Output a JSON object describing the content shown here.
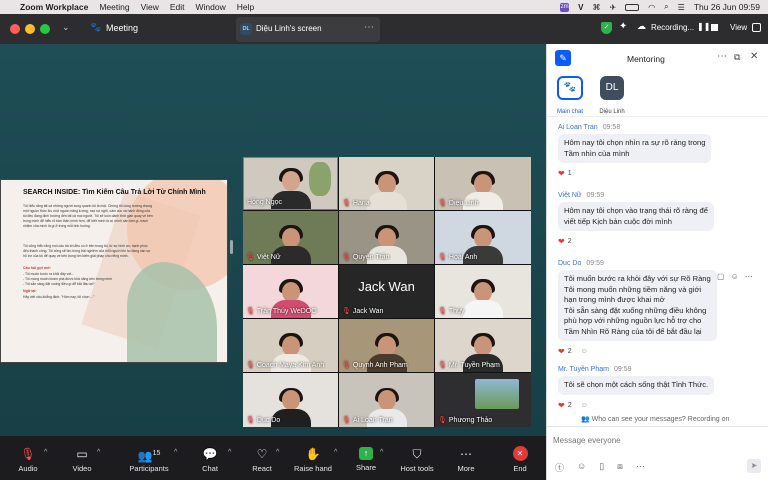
{
  "menubar": {
    "app": "Zoom Workplace",
    "items": [
      "Meeting",
      "View",
      "Edit",
      "Window",
      "Help"
    ],
    "clock": "Thu 26 Jun  09:59"
  },
  "titlebar": {
    "meeting_label": "Meeting",
    "share_tab_initials": "DL",
    "share_tab_label": "Diệu Linh's screen",
    "recording_label": "Recording...",
    "view_label": "View"
  },
  "slide": {
    "title": "SEARCH INSIDE: Tìm Kiếm Câu Trả Lời Từ Chính Mình",
    "para1": "Tôi hiểu rằng tất cả những người xung quanh tôi là một. Chúng tôi cùng hướng chung một nguồn thức ăn, một nguồn năng lượng, mọi sự nghĩ, cảm xúc và hành động của tôi đều đang định hướng đến tất cả mọi người. Tôi sẽ luôn dành thời gian quay về bên trong mình để hiểu rõ bản thân mình hơn, để biết mình là ai, mình cần làm gì, trách nhiệm của mình là gì ở trong mỗi tình huống.",
    "para2": "Tôi cũng hiểu rằng mọi câu trả lời đều có ở bên trong tôi, từ sự bình an, hạnh phúc đến thành công. Tôi cũng sẽ tìm trong trải nghiệm của mỗi người khi họ đang cần sự hỗ trợ của tôi để quay về bên trong tìm kiếm giải pháp cho riêng mình.",
    "heading1": "Câu hỏi gợi mở:",
    "q1": "- Tôi muốn bước ra khỏi đây với...",
    "q2": "- Tôi mong muốn khám phá được khả năng bên trong mình",
    "q3": "- Tôi sẵn sàng đặt xuống điều gì để bắt đầu lại?",
    "heading2": "Ngữ lại:",
    "q4": "Hãy viết câu khẳng định: \"Hôm nay, tôi chọn ...\""
  },
  "participants": [
    {
      "name": "Hồng Ngọc",
      "muted": false
    },
    {
      "name": "Hana",
      "muted": true
    },
    {
      "name": "Diệu Linh",
      "muted": true
    },
    {
      "name": "Việt Nữ",
      "muted": true
    },
    {
      "name": "Quyên Trần",
      "muted": true
    },
    {
      "name": "Hoài Anh",
      "muted": true
    },
    {
      "name": "Trần Thúy WeDOO",
      "muted": true
    },
    {
      "name": "Jack Wan",
      "muted": true
    },
    {
      "name": "Thúy",
      "muted": true
    },
    {
      "name": "Coach Maya Kim Anh",
      "muted": true
    },
    {
      "name": "Quynh Anh Pham",
      "muted": true
    },
    {
      "name": "Mr. Tuyền Phạm",
      "muted": true
    },
    {
      "name": "Duc Do",
      "muted": true
    },
    {
      "name": "Ai Loan Tran",
      "muted": true
    },
    {
      "name": "Phương Thảo",
      "muted": true
    }
  ],
  "jack_wan_big": "Jack Wan",
  "toolbar": {
    "audio": "Audio",
    "video": "Video",
    "participants": "Participants",
    "participants_count": "15",
    "chat": "Chat",
    "react": "React",
    "raise_hand": "Raise hand",
    "share": "Share",
    "host_tools": "Host tools",
    "more": "More",
    "end": "End"
  },
  "chat": {
    "title": "Mentoring",
    "tab_main": "Main chat",
    "tab_person_initials": "DL",
    "tab_person": "Diệu Linh",
    "messages": [
      {
        "sender": "Ai Loan Tran",
        "time": "09:58",
        "lines": [
          "Hôm nay tôi chọn nhìn ra sự rõ ràng trong",
          "Tầm nhìn của mình"
        ],
        "reaction": "1"
      },
      {
        "sender": "Việt Nữ",
        "time": "09:59",
        "lines": [
          "Hôm nay tôi chọn vào trạng thái rõ ràng để",
          "viết tiếp Kịch bản cuộc đời mình"
        ],
        "reaction": "2"
      },
      {
        "sender": "Duc Do",
        "time": "09:59",
        "lines": [
          "Tôi muốn bước ra khỏi đây với sự Rõ Ràng",
          "Tôi mong muốn những tiềm năng và giới",
          "hạn trong mình được khai mở",
          "Tôi sẵn sàng đặt xuống những điều không",
          "phù hợp với những nguồn lực hỗ trợ cho",
          "Tầm Nhìn Rõ Ràng của tôi để bắt đầu lại"
        ],
        "reaction": "2"
      },
      {
        "sender": "Mr. Tuyền Phạm",
        "time": "09:59",
        "lines": [
          "Tôi sẽ chọn một cách sống thật Tỉnh Thức."
        ],
        "reaction": "2"
      }
    ],
    "notice": "Who can see your messages? Recording on",
    "input_placeholder": "Message everyone"
  }
}
